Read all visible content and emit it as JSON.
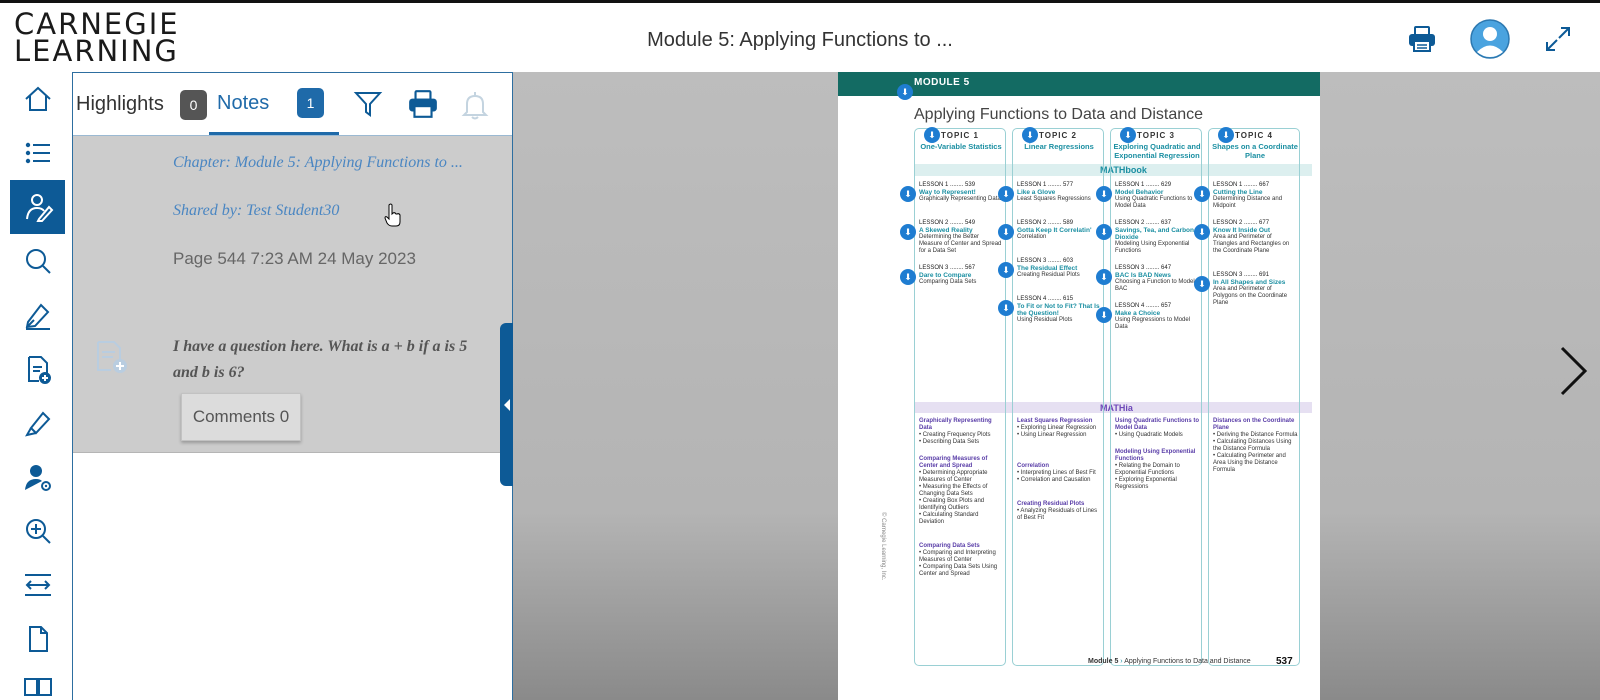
{
  "app": {
    "logo_line1": "CARNEGIE",
    "logo_line2": "LEARNING",
    "title": "Module 5: Applying Functions to ...",
    "accent": "#0d5a96"
  },
  "top_icons": [
    "printer-icon",
    "user-avatar-icon",
    "expand-icon"
  ],
  "left_toolbar": [
    "home-icon",
    "table-of-contents-icon",
    "notes-icon",
    "search-icon",
    "pen-icon",
    "add-page-icon",
    "highlighter-icon",
    "user-settings-icon",
    "zoom-in-icon",
    "fit-width-icon",
    "page-icon",
    "two-page-icon"
  ],
  "panel": {
    "tabs": {
      "highlights_label": "Highlights",
      "highlights_count": "0",
      "notes_label": "Notes",
      "notes_count": "1"
    },
    "note": {
      "chapter": "Chapter: Module 5: Applying Functions to ...",
      "shared_by": "Shared by: Test Student30",
      "meta": "Page 544   7:23 AM 24 May 2023",
      "text": "I have a question here. What is a + b if a is 5 and b is 6?",
      "comments": "Comments 0"
    }
  },
  "book": {
    "module_label": "MODULE 5",
    "title": "Applying Functions to Data and Distance",
    "mathbook_label": "MATHbook",
    "mathia_label": "MATHia",
    "footer_module": "Module 5",
    "footer_title": "Applying Functions to Data and Distance",
    "page_number": "537",
    "copyright": "© Carnegie Learning, Inc.",
    "topics": [
      {
        "num": "TOPIC 1",
        "name": "One-Variable Statistics",
        "lessons": [
          {
            "label": "LESSON 1",
            "page": "539",
            "title": "Way to Represent!",
            "desc": "Graphically Representing Data"
          },
          {
            "label": "LESSON 2",
            "page": "549",
            "title": "A Skewed Reality",
            "desc": "Determining the Better Measure of Center and Spread for a Data Set"
          },
          {
            "label": "LESSON 3",
            "page": "567",
            "title": "Dare to Compare",
            "desc": "Comparing Data Sets"
          }
        ],
        "mathia": [
          {
            "h": "Graphically Representing Data",
            "items": [
              "• Creating Frequency Plots",
              "• Describing Data Sets"
            ]
          },
          {
            "h": "Comparing Measures of Center and Spread",
            "items": [
              "• Determining Appropriate Measures of Center",
              "• Measuring the Effects of Changing Data Sets",
              "• Creating Box Plots and Identifying Outliers",
              "• Calculating Standard Deviation"
            ]
          },
          {
            "h": "Comparing Data Sets",
            "items": [
              "• Comparing and Interpreting Measures of Center",
              "• Comparing Data Sets Using Center and Spread"
            ]
          }
        ]
      },
      {
        "num": "TOPIC 2",
        "name": "Linear Regressions",
        "lessons": [
          {
            "label": "LESSON 1",
            "page": "577",
            "title": "Like a Glove",
            "desc": "Least Squares Regressions"
          },
          {
            "label": "LESSON 2",
            "page": "589",
            "title": "Gotta Keep It Correlatin'",
            "desc": "Correlation"
          },
          {
            "label": "LESSON 3",
            "page": "603",
            "title": "The Residual Effect",
            "desc": "Creating Residual Plots"
          },
          {
            "label": "LESSON 4",
            "page": "615",
            "title": "To Fit or Not to Fit? That Is the Question!",
            "desc": "Using Residual Plots"
          }
        ],
        "mathia": [
          {
            "h": "Least Squares Regression",
            "items": [
              "• Exploring Linear Regression",
              "• Using Linear Regression"
            ]
          },
          {
            "h": "Correlation",
            "items": [
              "• Interpreting Lines of Best Fit",
              "• Correlation and Causation"
            ]
          },
          {
            "h": "Creating Residual Plots",
            "items": [
              "• Analyzing Residuals of Lines of Best Fit"
            ]
          }
        ]
      },
      {
        "num": "TOPIC 3",
        "name": "Exploring Quadratic and Exponential Regression",
        "lessons": [
          {
            "label": "LESSON 1",
            "page": "629",
            "title": "Model Behavior",
            "desc": "Using Quadratic Functions to Model Data"
          },
          {
            "label": "LESSON 2",
            "page": "637",
            "title": "Savings, Tea, and Carbon Dioxide",
            "desc": "Modeling Using Exponential Functions"
          },
          {
            "label": "LESSON 3",
            "page": "647",
            "title": "BAC Is BAD News",
            "desc": "Choosing a Function to Model BAC"
          },
          {
            "label": "LESSON 4",
            "page": "657",
            "title": "Make a Choice",
            "desc": "Using Regressions to Model Data"
          }
        ],
        "mathia": [
          {
            "h": "Using Quadratic Functions to Model Data",
            "items": [
              "• Using Quadratic Models"
            ]
          },
          {
            "h": "Modeling Using Exponential Functions",
            "items": [
              "• Relating the Domain to Exponential Functions",
              "• Exploring Exponential Regressions"
            ]
          }
        ]
      },
      {
        "num": "TOPIC 4",
        "name": "Shapes on a Coordinate Plane",
        "lessons": [
          {
            "label": "LESSON 1",
            "page": "667",
            "title": "Cutting the Line",
            "desc": "Determining Distance and Midpoint"
          },
          {
            "label": "LESSON 2",
            "page": "677",
            "title": "Know It Inside Out",
            "desc": "Area and Perimeter of Triangles and Rectangles on the Coordinate Plane"
          },
          {
            "label": "LESSON 3",
            "page": "691",
            "title": "In All Shapes and Sizes",
            "desc": "Area and Perimeter of Polygons on the Coordinate Plane"
          }
        ],
        "mathia": [
          {
            "h": "Distances on the Coordinate Plane",
            "items": [
              "• Deriving the Distance Formula",
              "• Calculating Distances Using the Distance Formula",
              "• Calculating Perimeter and Area Using the Distance Formula"
            ]
          }
        ]
      }
    ]
  }
}
